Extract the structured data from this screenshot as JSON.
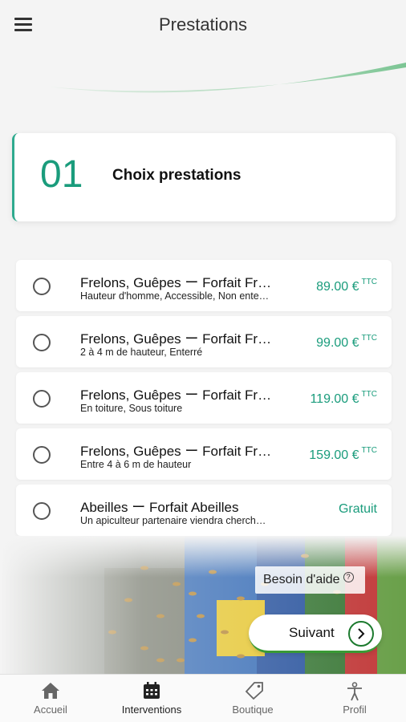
{
  "header": {
    "title": "Prestations"
  },
  "step": {
    "number": "01",
    "label": "Choix prestations"
  },
  "items": [
    {
      "title": "Frelons, Guêpes ー Forfait Frelons",
      "subtitle": "Hauteur d'homme, Accessible, Non enterré",
      "price": "89.00 €",
      "tax": "TTC"
    },
    {
      "title": "Frelons, Guêpes ー Forfait Frelons",
      "subtitle": "2 à 4 m de hauteur, Enterré",
      "price": "99.00 €",
      "tax": "TTC"
    },
    {
      "title": "Frelons, Guêpes ー Forfait Frelons",
      "subtitle": "En toiture, Sous toiture",
      "price": "119.00 €",
      "tax": "TTC"
    },
    {
      "title": "Frelons, Guêpes ー Forfait Frelons",
      "subtitle": "Entre 4 à 6 m de hauteur",
      "price": "159.00 €",
      "tax": "TTC"
    },
    {
      "title": "Abeilles ー Forfait Abeilles",
      "subtitle": "Un apiculteur partenaire viendra chercher l'essaim",
      "price": "Gratuit",
      "tax": ""
    }
  ],
  "help": {
    "label": "Besoin d'aide",
    "icon": "?"
  },
  "next": {
    "label": "Suivant"
  },
  "tabs": [
    {
      "label": "Accueil",
      "icon": "home-icon"
    },
    {
      "label": "Interventions",
      "icon": "calendar-icon"
    },
    {
      "label": "Boutique",
      "icon": "tag-icon"
    },
    {
      "label": "Profil",
      "icon": "person-icon"
    }
  ],
  "colors": {
    "accent": "#1a9c7c",
    "green_button": "#3a9a35"
  }
}
